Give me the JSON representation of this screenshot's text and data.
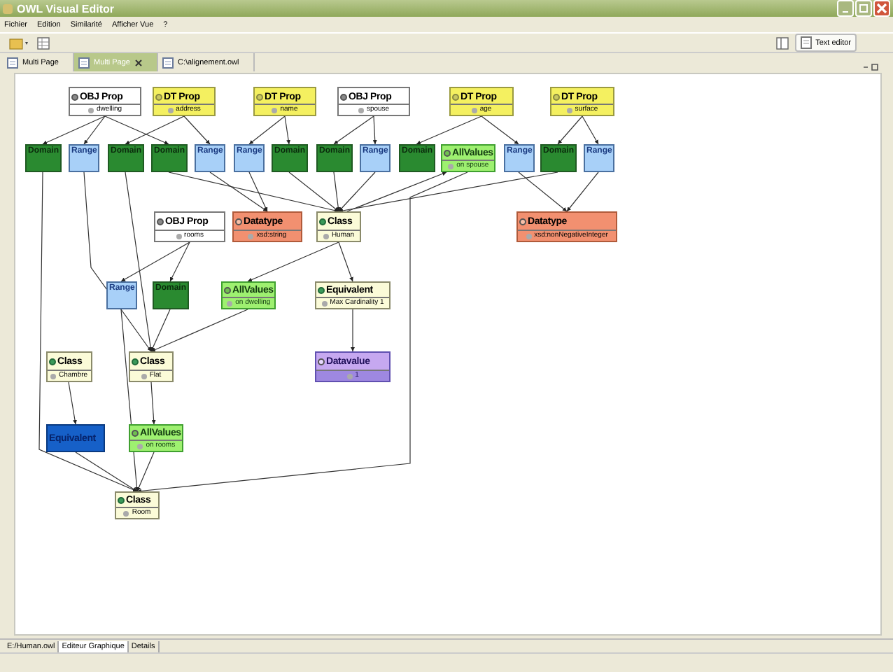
{
  "window": {
    "title": "OWL Visual Editor"
  },
  "menu": [
    "Fichier",
    "Edition",
    "Similarité",
    "Afficher Vue",
    "?"
  ],
  "toolbar": {
    "text_editor_button": "Text editor"
  },
  "tabs": [
    {
      "label": "Multi Page",
      "selected": false,
      "closable": false
    },
    {
      "label": "Multi Page",
      "selected": true,
      "closable": true
    },
    {
      "label": "C:\\alignement.owl",
      "selected": false,
      "closable": false
    }
  ],
  "diagram": {
    "nodes": [
      {
        "kind": "obj_prop",
        "title": "OBJ Prop",
        "subtitle": "dwelling",
        "selected": false
      },
      {
        "kind": "dt_prop",
        "title": "DT Prop",
        "subtitle": "address",
        "selected": false
      },
      {
        "kind": "dt_prop",
        "title": "DT Prop",
        "subtitle": "name",
        "selected": false
      },
      {
        "kind": "obj_prop",
        "title": "OBJ Prop",
        "subtitle": "spouse",
        "selected": false
      },
      {
        "kind": "dt_prop",
        "title": "DT Prop",
        "subtitle": "age",
        "selected": false
      },
      {
        "kind": "dt_prop",
        "title": "DT Prop",
        "subtitle": "surface",
        "selected": false
      },
      {
        "kind": "domain",
        "title": "Domain",
        "selected": false
      },
      {
        "kind": "range",
        "title": "Range",
        "selected": false
      },
      {
        "kind": "domain",
        "title": "Domain",
        "selected": false
      },
      {
        "kind": "domain",
        "title": "Domain",
        "selected": false
      },
      {
        "kind": "range",
        "title": "Range",
        "selected": false
      },
      {
        "kind": "range",
        "title": "Range",
        "selected": false
      },
      {
        "kind": "domain",
        "title": "Domain",
        "selected": false
      },
      {
        "kind": "domain",
        "title": "Domain",
        "selected": false
      },
      {
        "kind": "range",
        "title": "Range",
        "selected": false
      },
      {
        "kind": "domain",
        "title": "Domain",
        "selected": false
      },
      {
        "kind": "allvalues",
        "title": "AllValues",
        "subtitle": "on spouse",
        "selected": false
      },
      {
        "kind": "range",
        "title": "Range",
        "selected": false
      },
      {
        "kind": "domain",
        "title": "Domain",
        "selected": false
      },
      {
        "kind": "range",
        "title": "Range",
        "selected": false
      },
      {
        "kind": "obj_prop",
        "title": "OBJ Prop",
        "subtitle": "rooms",
        "selected": false
      },
      {
        "kind": "datatype",
        "title": "Datatype",
        "subtitle": "xsd:string",
        "selected": false
      },
      {
        "kind": "class",
        "title": "Class",
        "subtitle": "Human",
        "selected": false
      },
      {
        "kind": "datatype",
        "title": "Datatype",
        "subtitle": "xsd:nonNegativeInteger",
        "selected": false
      },
      {
        "kind": "range",
        "title": "Range",
        "selected": false
      },
      {
        "kind": "domain",
        "title": "Domain",
        "selected": false
      },
      {
        "kind": "allvalues",
        "title": "AllValues",
        "subtitle": "on dwelling",
        "selected": false
      },
      {
        "kind": "equivalent",
        "title": "Equivalent",
        "subtitle": "Max Cardinality  1",
        "selected": false
      },
      {
        "kind": "class",
        "title": "Class",
        "subtitle": "Chambre",
        "selected": false
      },
      {
        "kind": "class",
        "title": "Class",
        "subtitle": "Flat",
        "selected": false
      },
      {
        "kind": "datavalue",
        "title": "Datavalue",
        "subtitle": "1",
        "selected": false
      },
      {
        "kind": "equivalent",
        "title": "Equivalent",
        "selected": true
      },
      {
        "kind": "allvalues",
        "title": "AllValues",
        "subtitle": "on rooms",
        "selected": false
      },
      {
        "kind": "class",
        "title": "Class",
        "subtitle": "Room",
        "selected": false
      }
    ]
  },
  "bottom_tabs": [
    {
      "label": "E:/Human.owl",
      "selected": false
    },
    {
      "label": "Editeur Graphique",
      "selected": true
    },
    {
      "label": "Details",
      "selected": false
    }
  ]
}
